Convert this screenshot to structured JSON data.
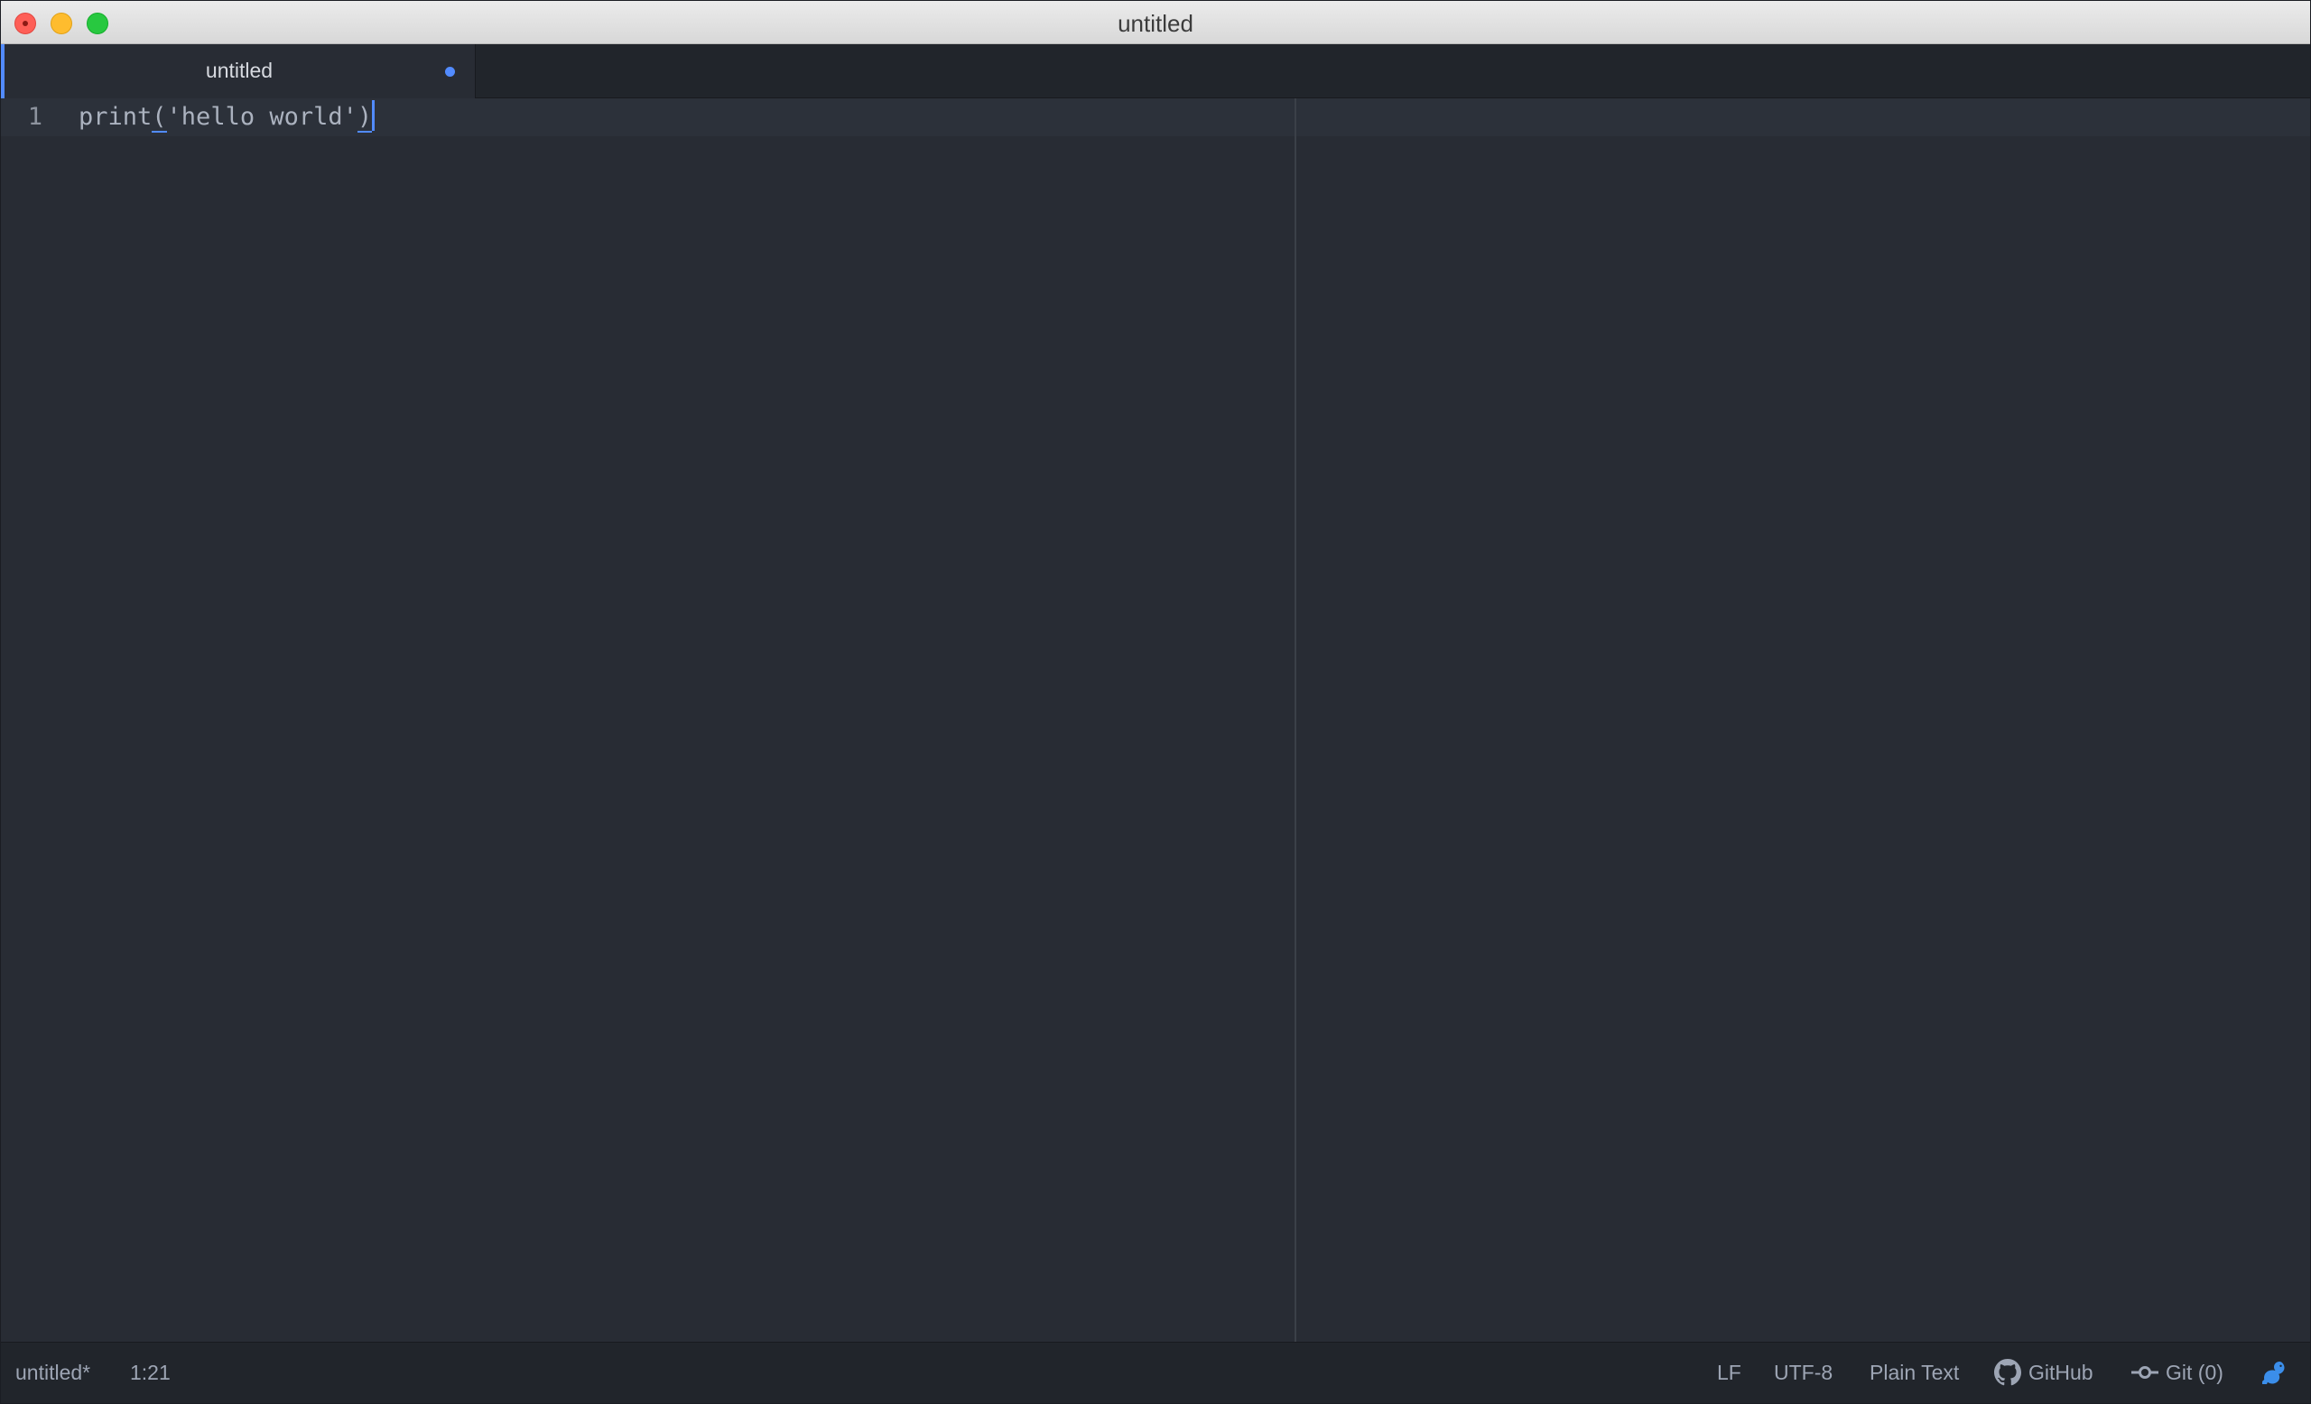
{
  "window": {
    "title": "untitled"
  },
  "tabs": [
    {
      "title": "untitled",
      "modified": true
    }
  ],
  "editor": {
    "lines": [
      {
        "number": "1",
        "code_before": "print",
        "open_paren": "(",
        "string": "'hello world'",
        "close_paren": ")"
      }
    ]
  },
  "status_bar": {
    "file_name": "untitled*",
    "cursor_position": "1:21",
    "line_ending": "LF",
    "encoding": "UTF-8",
    "grammar": "Plain Text",
    "github_label": "GitHub",
    "git_label": "Git (0)",
    "icons": {
      "github": "github-icon",
      "git": "git-commit-icon",
      "squirrel": "squirrel-update-icon"
    }
  },
  "colors": {
    "accent": "#528bff",
    "editor_background": "#282c34",
    "panel_background": "#21252b",
    "text": "#abb2bf"
  }
}
